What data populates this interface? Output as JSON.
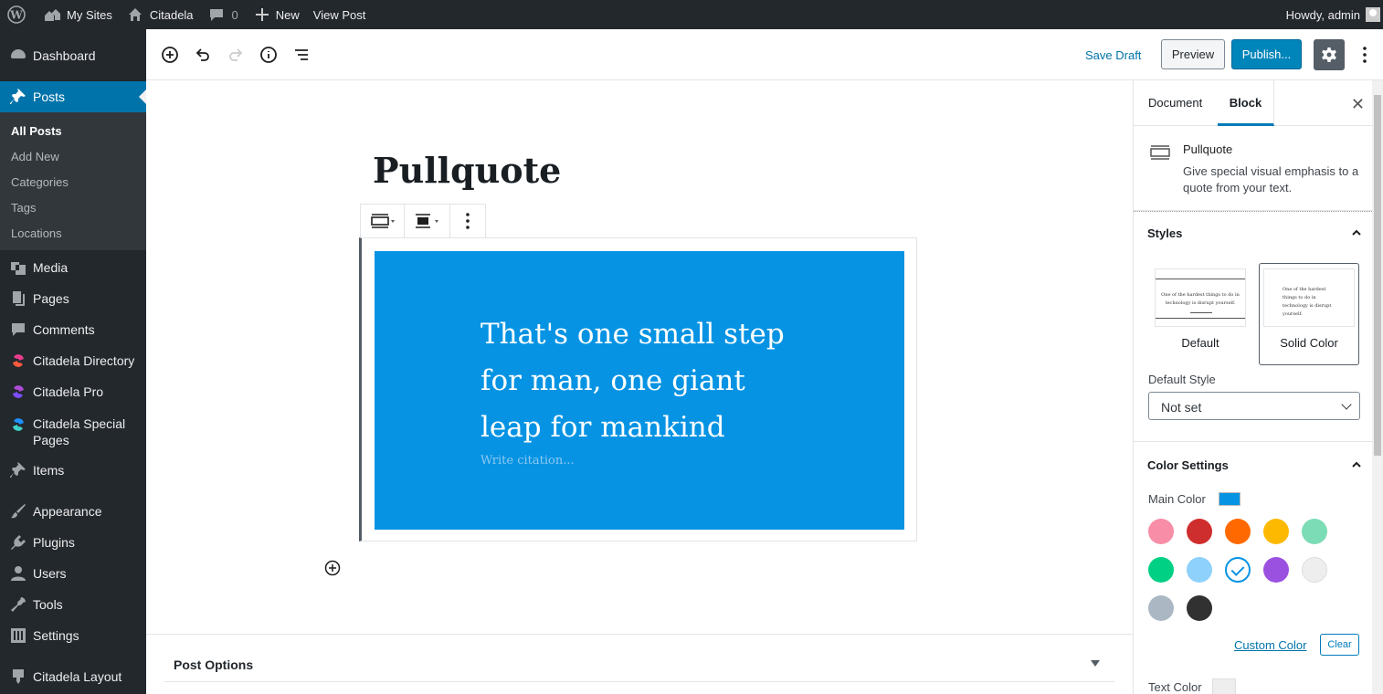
{
  "admin_bar": {
    "my_sites": "My Sites",
    "site_name": "Citadela",
    "comment_count": "0",
    "new_label": "New",
    "view_post": "View Post",
    "howdy": "Howdy, admin"
  },
  "sidebar": {
    "dashboard": "Dashboard",
    "posts": "Posts",
    "posts_sub": [
      "All Posts",
      "Add New",
      "Categories",
      "Tags",
      "Locations"
    ],
    "media": "Media",
    "pages": "Pages",
    "comments": "Comments",
    "citadela_directory": "Citadela Directory",
    "citadela_pro": "Citadela Pro",
    "citadela_special_pages": "Citadela Special Pages",
    "items": "Items",
    "appearance": "Appearance",
    "plugins": "Plugins",
    "users": "Users",
    "tools": "Tools",
    "settings": "Settings",
    "citadela_layout": "Citadela Layout"
  },
  "header": {
    "save_draft": "Save Draft",
    "preview": "Preview",
    "publish": "Publish..."
  },
  "editor": {
    "post_title": "Pullquote",
    "quote_text": "That's one small step for man, one giant leap for mankind",
    "citation_placeholder": "Write citation...",
    "post_options": "Post Options"
  },
  "panel": {
    "tab_document": "Document",
    "tab_block": "Block",
    "block_name": "Pullquote",
    "block_description": "Give special visual emphasis to a quote from your text.",
    "styles_title": "Styles",
    "style_default": "Default",
    "style_solid": "Solid Color",
    "preview_text": "One of the hardest things to do in technology is disrupt yourself.",
    "default_style_label": "Default Style",
    "default_style_value": "Not set",
    "color_settings_title": "Color Settings",
    "main_color_label": "Main Color",
    "main_color": "#0693e3",
    "swatches": [
      "#f78da7",
      "#cf2e2e",
      "#ff6900",
      "#fcb900",
      "#7bdcb5",
      "#00d084",
      "#8ed1fc",
      "#0693e3",
      "#9b51e0",
      "#eeeeee",
      "#abb8c3",
      "#313131"
    ],
    "selected_swatch": "#0693e3",
    "custom_color": "Custom Color",
    "clear": "Clear",
    "text_color_label": "Text Color"
  }
}
